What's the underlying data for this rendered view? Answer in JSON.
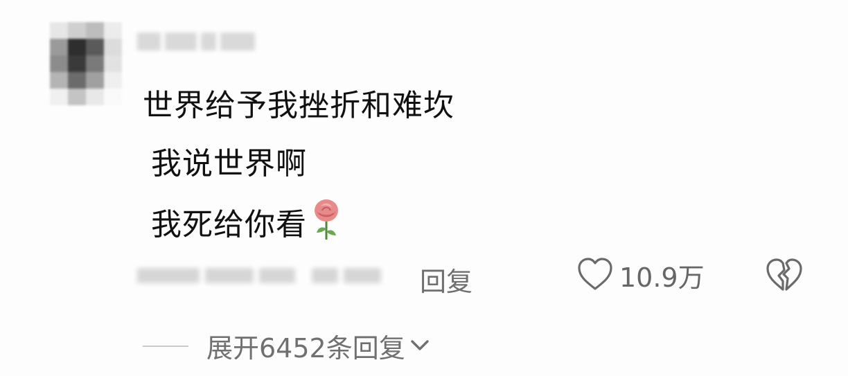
{
  "comment": {
    "lines": [
      "世界给予我挫折和难坎",
      "我说世界啊",
      "我死给你看"
    ],
    "emoji": "rose"
  },
  "actions": {
    "reply_label": "回复",
    "like_count": "10.9万",
    "like_icon": "heart-outline-icon",
    "dislike_icon": "broken-heart-icon"
  },
  "replies": {
    "expand_label": "展开6452条回复",
    "expand_icon": "chevron-down-icon"
  },
  "colors": {
    "text_primary": "#111111",
    "text_secondary": "#6f6f6f",
    "rose_petal": "#e88a8a",
    "rose_leaf": "#6aa84f"
  }
}
